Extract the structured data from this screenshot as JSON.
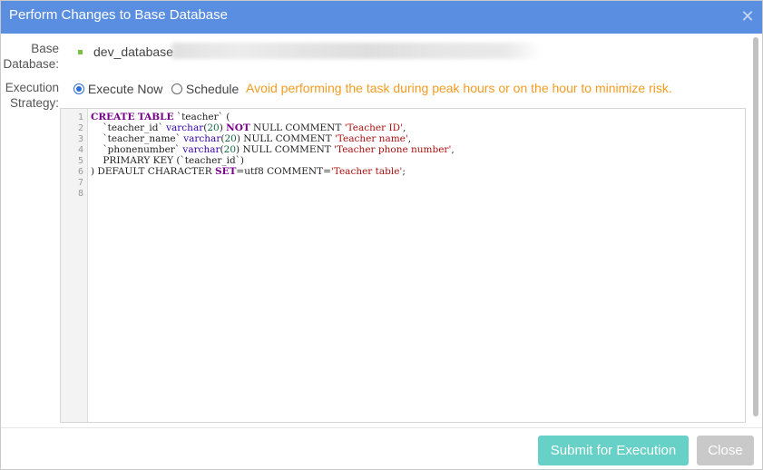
{
  "dialog": {
    "title": "Perform Changes to Base Database",
    "close_icon": "close-icon"
  },
  "form": {
    "base_db_label_1": "Base",
    "base_db_label_2": "Database:",
    "base_db_value": "dev_database",
    "strategy_label_1": "Execution",
    "strategy_label_2": "Strategy:",
    "options": [
      {
        "label": "Execute Now",
        "selected": true
      },
      {
        "label": "Schedule",
        "selected": false
      }
    ],
    "warning": "Avoid performing the task during peak hours or on the hour to minimize risk."
  },
  "editor": {
    "line_numbers": [
      "1",
      "2",
      "3",
      "4",
      "5",
      "6",
      "7",
      "8"
    ],
    "lines": [
      "CREATE TABLE `teacher` (",
      "    `teacher_id` varchar(20) NOT NULL COMMENT 'Teacher ID',",
      "    `teacher_name` varchar(20) NULL COMMENT 'Teacher name',",
      "    `phonenumber` varchar(20) NULL COMMENT 'Teacher phone number',",
      "    PRIMARY KEY (`teacher_id`)",
      ") DEFAULT CHARACTER SET=utf8 COMMENT='Teacher table';",
      "",
      ""
    ]
  },
  "buttons": {
    "submit": "Submit for Execution",
    "close": "Close"
  },
  "colors": {
    "header": "#5a8ee0",
    "warning": "#f39c22",
    "submit_button": "#67d1c7",
    "close_button": "#c9c9c9"
  }
}
